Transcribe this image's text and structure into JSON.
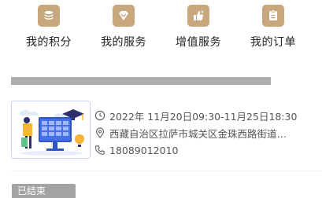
{
  "quick_nav": [
    {
      "label": "我的积分",
      "icon": "coins-icon"
    },
    {
      "label": "我的服务",
      "icon": "diamond-icon"
    },
    {
      "label": "增值服务",
      "icon": "thumbs-up-icon"
    },
    {
      "label": "我的订单",
      "icon": "order-list-icon"
    }
  ],
  "accent_color": "#c9a77c",
  "event": {
    "time": "2022年 11月20日09:30-11月25日18:30",
    "address": "西藏自治区拉萨市城关区金珠西路街道…",
    "phone": "18089012010",
    "status": "已结束"
  }
}
